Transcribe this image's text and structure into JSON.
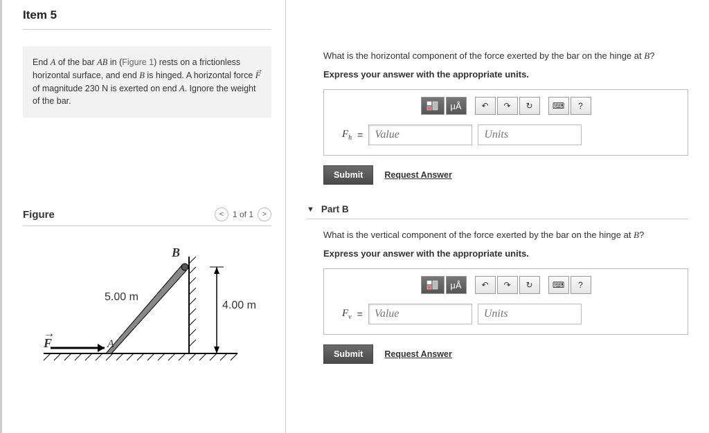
{
  "item_title": "Item 5",
  "problem": {
    "line1_pre": "End ",
    "var_A": "A",
    "line1_mid": " of the bar ",
    "var_AB": "AB",
    "line1_post": " in (",
    "fig_ref": "Figure 1",
    "line1_end": ") rests on a frictionless horizontal surface, and end ",
    "var_B": "B",
    "line2": " is hinged. A horizontal force ",
    "var_F": "F",
    "line3": " of magnitude 230 ",
    "unit_N": "N",
    "line4": " is exerted on end ",
    "var_A2": "A",
    "line5": ". Ignore the weight of the bar."
  },
  "figure": {
    "title": "Figure",
    "pager_prev": "<",
    "pager_text": "1 of 1",
    "pager_next": ">",
    "label_B": "B",
    "label_A": "A",
    "label_F": "F",
    "dim_hyp": "5.00 m",
    "dim_vert": "4.00 m"
  },
  "partA": {
    "question_pre": "What is the horizontal component of the force exerted by the bar on the hinge at ",
    "question_var": "B",
    "question_post": "?",
    "instruction": "Express your answer with the appropriate units.",
    "var_label": "F",
    "var_sub": "h",
    "eq": "=",
    "value_ph": "Value",
    "units_ph": "Units",
    "submit": "Submit",
    "request": "Request Answer",
    "tb_units": "μÅ"
  },
  "partB": {
    "caret": "▼",
    "title": "Part B",
    "question_pre": "What is the vertical component of the force exerted by the bar on the hinge at ",
    "question_var": "B",
    "question_post": "?",
    "instruction": "Express your answer with the appropriate units.",
    "var_label": "F",
    "var_sub": "v",
    "eq": "=",
    "value_ph": "Value",
    "units_ph": "Units",
    "submit": "Submit",
    "request": "Request Answer",
    "tb_units": "μÅ"
  },
  "icons": {
    "undo": "↶",
    "redo": "↷",
    "reset": "↻",
    "keyboard": "⌨",
    "help": "?"
  }
}
